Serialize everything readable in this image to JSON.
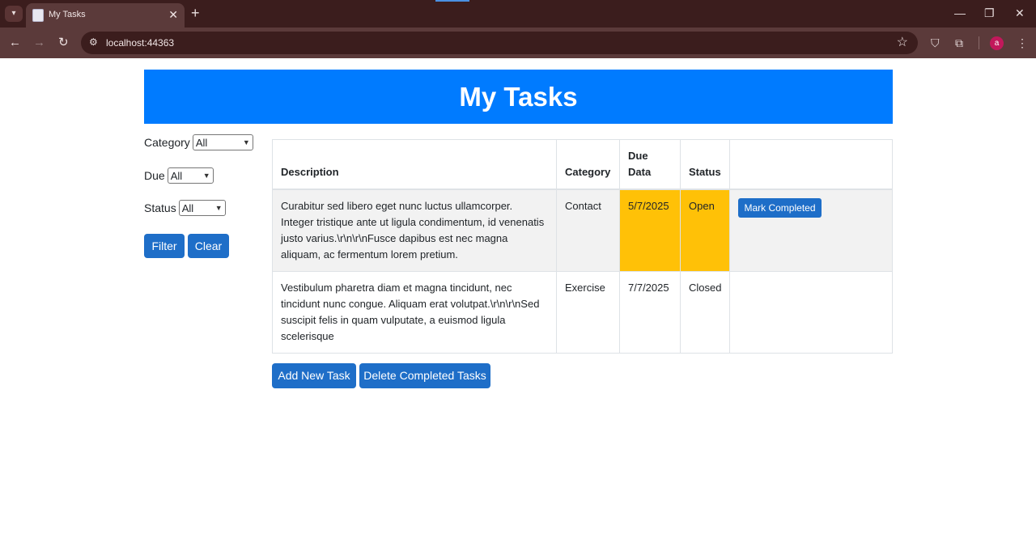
{
  "browser": {
    "tab_title": "My Tasks",
    "url": "localhost:44363",
    "profile_initial": "a"
  },
  "page": {
    "title": "My Tasks",
    "accent_color": "#007bff",
    "button_color": "#1e6ec8",
    "highlight_color": "#ffc107"
  },
  "filters": {
    "category": {
      "label": "Category",
      "value": "All"
    },
    "due": {
      "label": "Due",
      "value": "All"
    },
    "status": {
      "label": "Status",
      "value": "All"
    },
    "filter_button": "Filter",
    "clear_button": "Clear"
  },
  "table": {
    "headers": [
      "Description",
      "Category",
      "Due\nData",
      "Status",
      ""
    ],
    "header_due_line1": "Due",
    "header_due_line2": "Data",
    "rows": [
      {
        "description": "Curabitur sed libero eget nunc luctus ullamcorper. Integer tristique ante ut ligula condimentum, id venenatis justo varius.\\r\\n\\r\\nFusce dapibus est nec magna aliquam, ac fermentum lorem pretium.",
        "category": "Contact",
        "due": "5/7/2025",
        "status": "Open",
        "action": "Mark Completed"
      },
      {
        "description": "Vestibulum pharetra diam et magna tincidunt, nec tincidunt nunc congue. Aliquam erat volutpat.\\r\\n\\r\\nSed suscipit felis in quam vulputate, a euismod ligula scelerisque",
        "category": "Exercise",
        "due": "7/7/2025",
        "status": "Closed",
        "action": ""
      }
    ]
  },
  "actions": {
    "add_task": "Add New Task",
    "delete_completed": "Delete Completed Tasks"
  }
}
